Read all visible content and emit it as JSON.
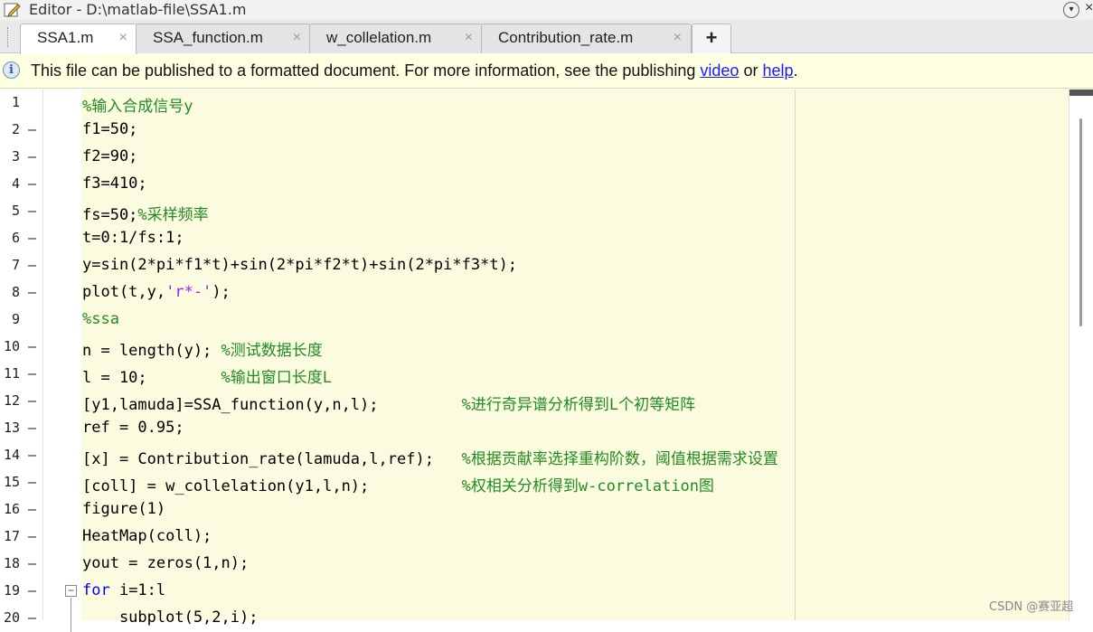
{
  "window": {
    "title": "Editor - D:\\matlab-file\\SSA1.m",
    "menu_glyph": "▾",
    "close_glyph": "×"
  },
  "tabs": [
    {
      "label": "SSA1.m",
      "active": true
    },
    {
      "label": "SSA_function.m",
      "active": false
    },
    {
      "label": "w_collelation.m",
      "active": false
    },
    {
      "label": "Contribution_rate.m",
      "active": false
    }
  ],
  "tab_close_glyph": "×",
  "add_tab_glyph": "+",
  "info_bar": {
    "icon": "info-icon",
    "icon_glyph": "i",
    "text_before": "This file can be published to a formatted document. For more information, see the publishing ",
    "link1": "video",
    "text_middle": " or ",
    "link2": "help",
    "text_after": "."
  },
  "fold_glyph": "−",
  "code_lines": [
    {
      "num": "1",
      "exec": "",
      "code": "",
      "comment": "%输入合成信号y"
    },
    {
      "num": "2",
      "exec": "–",
      "code": "f1=50;",
      "comment": ""
    },
    {
      "num": "3",
      "exec": "–",
      "code": "f2=90;",
      "comment": ""
    },
    {
      "num": "4",
      "exec": "–",
      "code": "f3=410;",
      "comment": ""
    },
    {
      "num": "5",
      "exec": "–",
      "code": "fs=50;",
      "comment": "%采样频率"
    },
    {
      "num": "6",
      "exec": "–",
      "code": "t=0:1/fs:1;",
      "comment": ""
    },
    {
      "num": "7",
      "exec": "–",
      "code": "y=sin(2*pi*f1*t)+sin(2*pi*f2*t)+sin(2*pi*f3*t);",
      "comment": ""
    },
    {
      "num": "8",
      "exec": "–",
      "code_before": "plot(t,y,",
      "string": "'r*-'",
      "code_after": ");"
    },
    {
      "num": "9",
      "exec": "",
      "code": "",
      "comment": "%ssa"
    },
    {
      "num": "10",
      "exec": "–",
      "code": "n = length(y); ",
      "comment": "%测试数据长度"
    },
    {
      "num": "11",
      "exec": "–",
      "code": "l = 10;        ",
      "comment": "%输出窗口长度L"
    },
    {
      "num": "12",
      "exec": "–",
      "code": "[y1,lamuda]=SSA_function(y,n,l);         ",
      "comment": "%进行奇异谱分析得到L个初等矩阵"
    },
    {
      "num": "13",
      "exec": "–",
      "code": "ref = 0.95;",
      "comment": ""
    },
    {
      "num": "14",
      "exec": "–",
      "code": "[x] = Contribution_rate(lamuda,l,ref);   ",
      "comment": "%根据贡献率选择重构阶数，阈值根据需求设置"
    },
    {
      "num": "15",
      "exec": "–",
      "code": "[coll] = w_collelation(y1,l,n);          ",
      "comment": "%权相关分析得到w-correlation图"
    },
    {
      "num": "16",
      "exec": "–",
      "code": "figure(1)",
      "comment": ""
    },
    {
      "num": "17",
      "exec": "–",
      "code": "HeatMap(coll);",
      "comment": ""
    },
    {
      "num": "18",
      "exec": "–",
      "code": "yout = zeros(1,n);",
      "comment": ""
    },
    {
      "num": "19",
      "exec": "–",
      "keyword": "for",
      "code": " i=1:l",
      "comment": ""
    },
    {
      "num": "20",
      "exec": "–",
      "code": "    subplot(5,2,i);",
      "comment": ""
    }
  ],
  "watermark": "CSDN @赛亚超"
}
